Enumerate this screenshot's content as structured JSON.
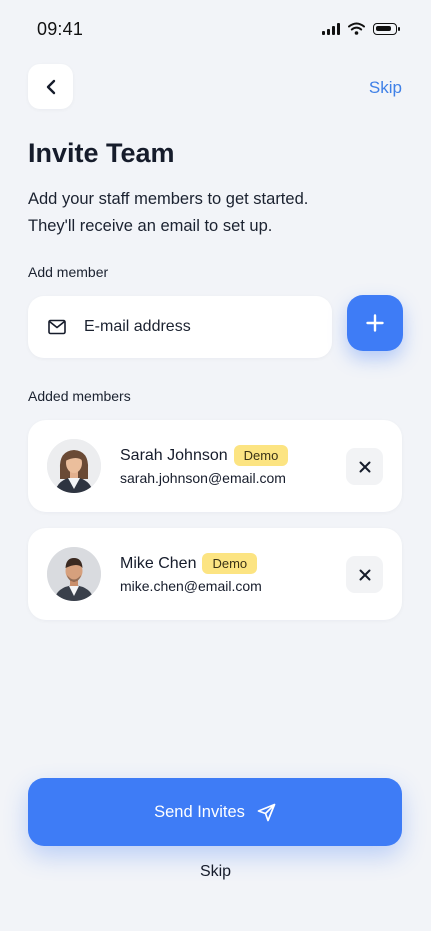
{
  "status_bar": {
    "time": "09:41"
  },
  "header": {
    "skip_label": "Skip",
    "title": "Invite Team",
    "subtitle_line1": "Add your staff members to get started.",
    "subtitle_line2": "They'll receive an email to set up."
  },
  "add_member": {
    "label": "Add member",
    "email_placeholder": "E-mail address",
    "email_value": ""
  },
  "added_members": {
    "label": "Added members",
    "items": [
      {
        "name": "Sarah Johnson",
        "badge": "Demo",
        "email": "sarah.johnson@email.com"
      },
      {
        "name": "Mike Chen",
        "badge": "Demo",
        "email": "mike.chen@email.com"
      }
    ]
  },
  "footer": {
    "send_label": "Send Invites",
    "skip_label": "Skip"
  },
  "colors": {
    "accent": "#3E7CF6",
    "link": "#3F80E7",
    "badge": "#FCE482",
    "background": "#F2F4F8"
  },
  "icons": [
    "back-chevron-icon",
    "mail-icon",
    "plus-icon",
    "close-icon",
    "send-icon",
    "signal-icon",
    "wifi-icon",
    "battery-icon"
  ]
}
